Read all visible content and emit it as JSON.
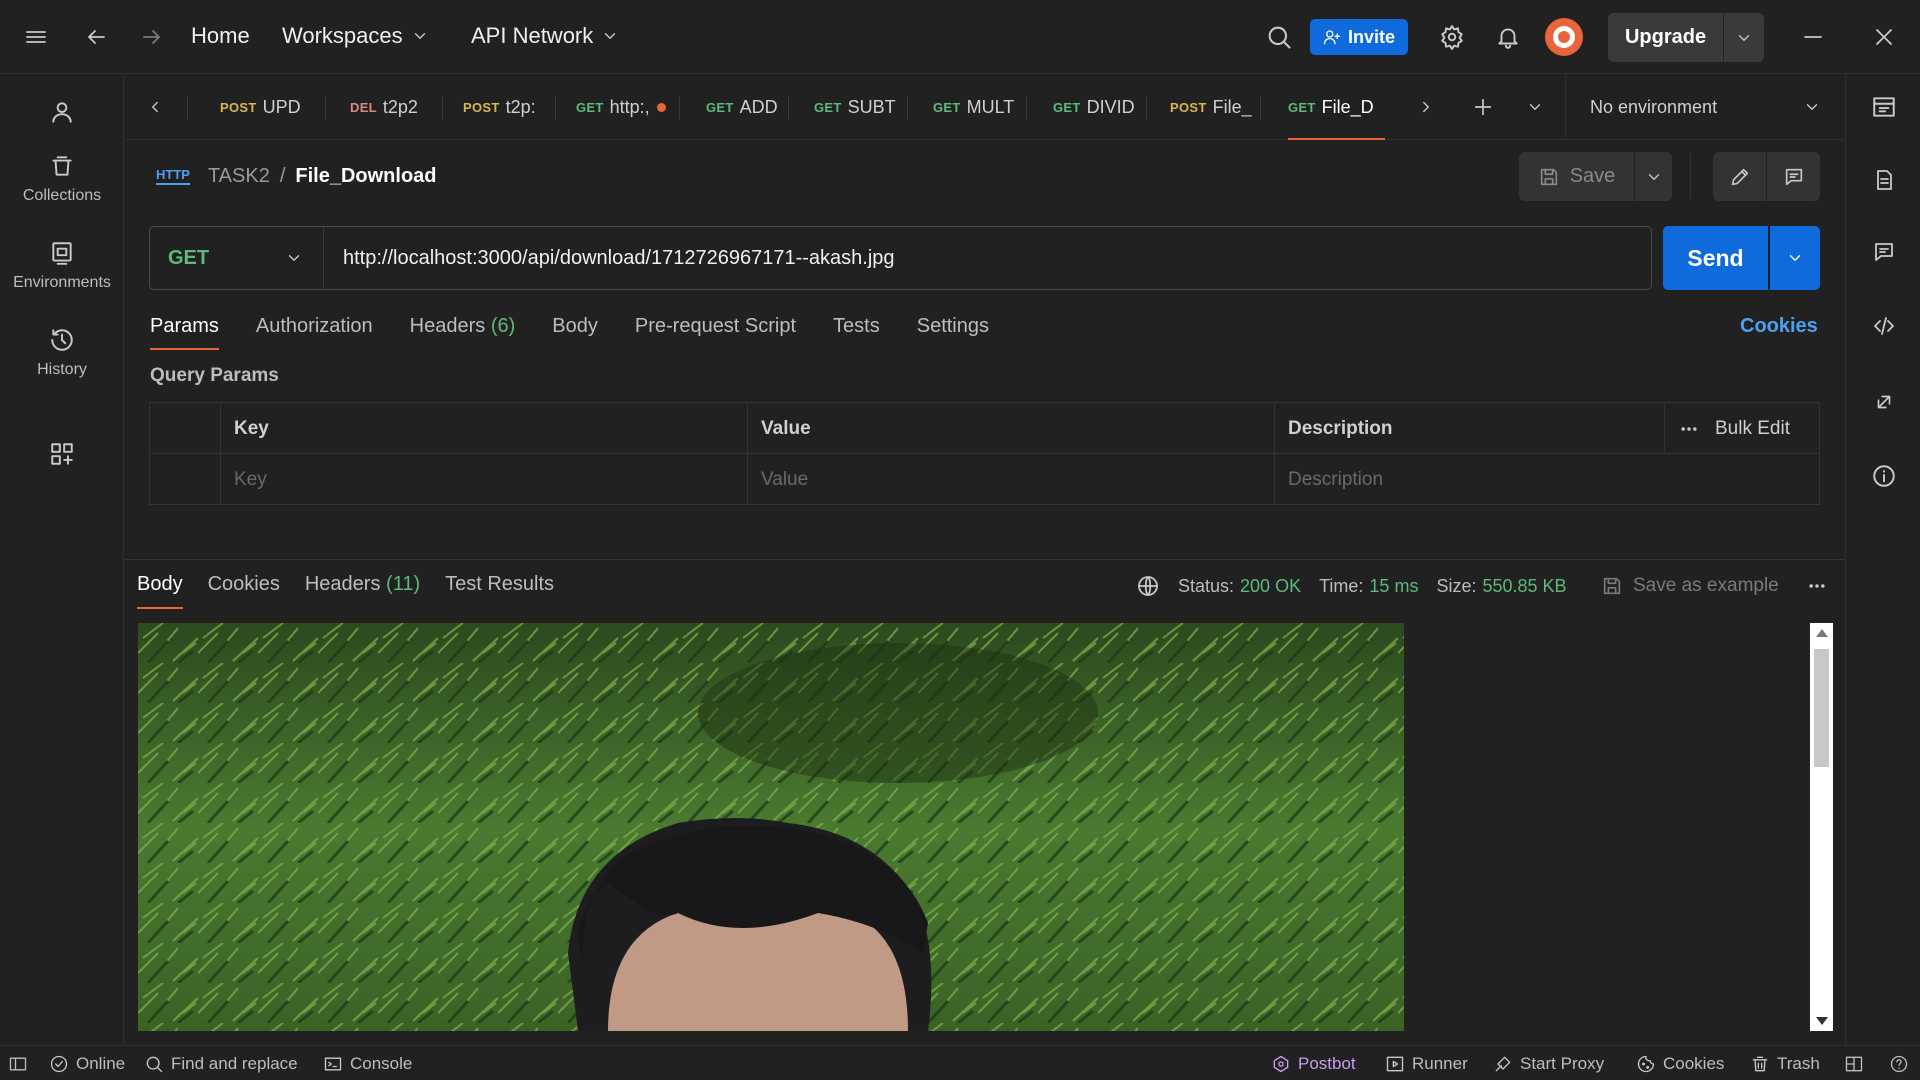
{
  "topbar": {
    "home": "Home",
    "workspaces": "Workspaces",
    "api_network": "API Network",
    "invite": "Invite",
    "upgrade": "Upgrade"
  },
  "sidebar": {
    "items": [
      {
        "label": "Collections"
      },
      {
        "label": "Environments"
      },
      {
        "label": "History"
      }
    ]
  },
  "tabs": [
    {
      "method": "POST",
      "name": "UPD"
    },
    {
      "method": "DEL",
      "name": "t2p2"
    },
    {
      "method": "POST",
      "name": "t2p:"
    },
    {
      "method": "GET",
      "name": "http:,"
    },
    {
      "method": "GET",
      "name": "ADD"
    },
    {
      "method": "GET",
      "name": "SUBT"
    },
    {
      "method": "GET",
      "name": "MULT"
    },
    {
      "method": "GET",
      "name": "DIVID"
    },
    {
      "method": "POST",
      "name": "File_"
    },
    {
      "method": "GET",
      "name": "File_D"
    }
  ],
  "environment": "No environment",
  "breadcrumb": {
    "collection": "TASK2",
    "separator": "/",
    "request": "File_Download"
  },
  "save_label": "Save",
  "request": {
    "method": "GET",
    "url": "http://localhost:3000/api/download/1712726967171--akash.jpg",
    "send_label": "Send",
    "tabs": {
      "params": "Params",
      "authorization": "Authorization",
      "headers": "Headers",
      "headers_count": "(6)",
      "body": "Body",
      "prerequest": "Pre-request Script",
      "tests": "Tests",
      "settings": "Settings"
    },
    "cookies": "Cookies",
    "query_params_title": "Query Params",
    "table": {
      "headers": {
        "key": "Key",
        "value": "Value",
        "description": "Description",
        "bulk_edit": "Bulk Edit"
      },
      "placeholders": {
        "key": "Key",
        "value": "Value",
        "description": "Description"
      }
    }
  },
  "response": {
    "tabs": {
      "body": "Body",
      "cookies": "Cookies",
      "headers": "Headers",
      "headers_count": "(11)",
      "test_results": "Test Results"
    },
    "status_label": "Status:",
    "status_value": "200 OK",
    "time_label": "Time:",
    "time_value": "15 ms",
    "size_label": "Size:",
    "size_value": "550.85 KB",
    "save_example": "Save as example"
  },
  "statusbar": {
    "online": "Online",
    "find_replace": "Find and replace",
    "console": "Console",
    "postbot": "Postbot",
    "runner": "Runner",
    "start_proxy": "Start Proxy",
    "cookies": "Cookies",
    "trash": "Trash"
  },
  "colors": {
    "accent": "#e8643a",
    "primary": "#0f6adb",
    "get": "#5fb87c",
    "post": "#d7b84a",
    "del": "#d98a80",
    "link": "#4f9ff0",
    "postbot": "#c89cf0"
  }
}
